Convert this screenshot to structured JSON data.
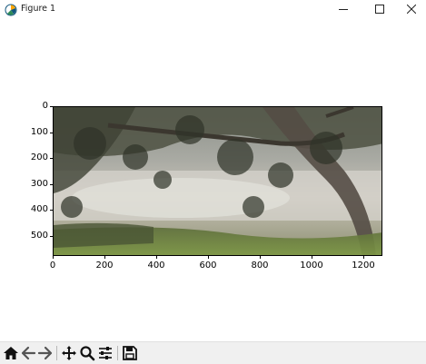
{
  "window": {
    "title": "Figure 1",
    "app_icon": "matplotlib-figure-icon",
    "controls": [
      "minimize-icon",
      "maximize-icon",
      "close-icon"
    ]
  },
  "axes": {
    "y_ticks": [
      "0",
      "100",
      "200",
      "300",
      "400",
      "500"
    ],
    "x_ticks": [
      "0",
      "200",
      "400",
      "600",
      "800",
      "1000",
      "1200"
    ],
    "image_content": "tree-branches-over-lake-photo"
  },
  "toolbar": {
    "tools": [
      "home-icon",
      "back-icon",
      "forward-icon",
      "pan-icon",
      "zoom-icon",
      "configure-subplots-icon",
      "save-icon"
    ]
  }
}
